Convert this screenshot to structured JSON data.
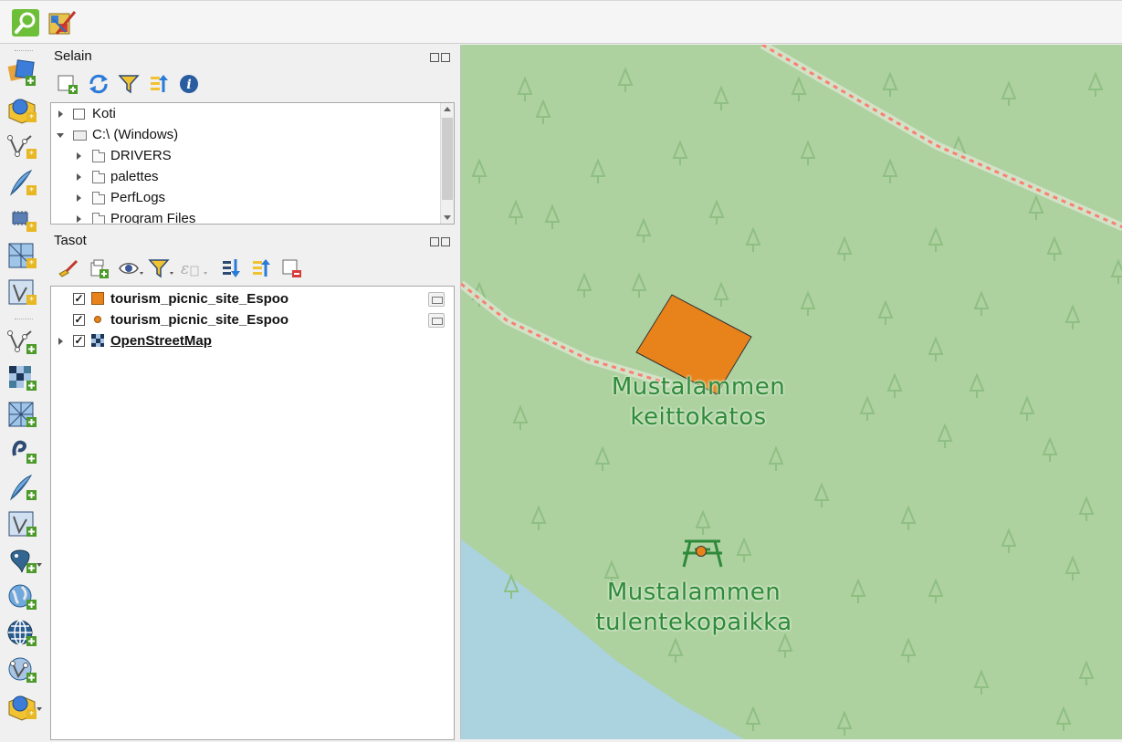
{
  "top_toolbar": {
    "buttons": [
      {
        "name": "identify-features",
        "icon": "magnifier-icon"
      },
      {
        "name": "style-manager",
        "icon": "paint-palette-icon"
      }
    ]
  },
  "left_toolbar": {
    "buttons": [
      "open-data-source-manager-icon",
      "new-geopackage-layer-icon",
      "new-shapefile-layer-icon",
      "new-temporary-scratch-layer-icon",
      "new-virtual-layer-icon",
      "new-mesh-layer-icon",
      "new-gps-layer-icon",
      "add-vector-layer-icon",
      "add-raster-layer-icon",
      "add-mesh-layer-icon",
      "add-delimited-text-layer-icon",
      "add-spatialite-layer-icon",
      "add-virtual-layer-icon",
      "add-postgis-layer-icon",
      "add-wms-layer-icon",
      "add-xyz-layer-icon",
      "add-wfs-layer-icon",
      "add-arcgis-layer-icon"
    ]
  },
  "browser_panel": {
    "title": "Selain",
    "toolbar": [
      "add-selected-layers-icon",
      "refresh-icon",
      "filter-icon",
      "collapse-all-icon",
      "info-icon"
    ],
    "items": [
      {
        "label": "Koti",
        "icon": "home-icon",
        "level": 0,
        "expanded": false
      },
      {
        "label": "C:\\ (Windows)",
        "icon": "drive-icon",
        "level": 0,
        "expanded": true
      },
      {
        "label": "DRIVERS",
        "icon": "folder-icon",
        "level": 1,
        "expanded": false
      },
      {
        "label": "palettes",
        "icon": "folder-icon",
        "level": 1,
        "expanded": false
      },
      {
        "label": "PerfLogs",
        "icon": "folder-icon",
        "level": 1,
        "expanded": false
      },
      {
        "label": "Program Files",
        "icon": "folder-icon",
        "level": 1,
        "expanded": false
      }
    ]
  },
  "layers_panel": {
    "title": "Tasot",
    "toolbar": [
      "style-icon",
      "add-group-icon",
      "manage-visibility-icon",
      "filter-legend-icon",
      "filter-by-expression-icon",
      "expand-all-icon",
      "collapse-all-icon",
      "remove-layer-icon"
    ],
    "layers": [
      {
        "label": "tourism_picnic_site_Espoo",
        "symbol": "polygon",
        "color": "#e8831b",
        "checked": true,
        "editable_indicator": true
      },
      {
        "label": "tourism_picnic_site_Espoo",
        "symbol": "point",
        "color": "#e8831b",
        "checked": true,
        "editable_indicator": true
      },
      {
        "label": "OpenStreetMap",
        "symbol": "raster",
        "checked": true,
        "editable_indicator": false
      }
    ]
  },
  "map": {
    "labels": [
      {
        "id": "label1",
        "lines": [
          "Mustalammen",
          "keittokatos"
        ]
      },
      {
        "id": "label2",
        "lines": [
          "Mustalammen",
          "tulentekopaikka"
        ]
      }
    ],
    "colors": {
      "background": "#aed1a0",
      "water": "#aad3df",
      "path": "#fa8072",
      "polygon": "#e8831b",
      "point": "#e8831b",
      "label": "#2f8a3a"
    }
  }
}
